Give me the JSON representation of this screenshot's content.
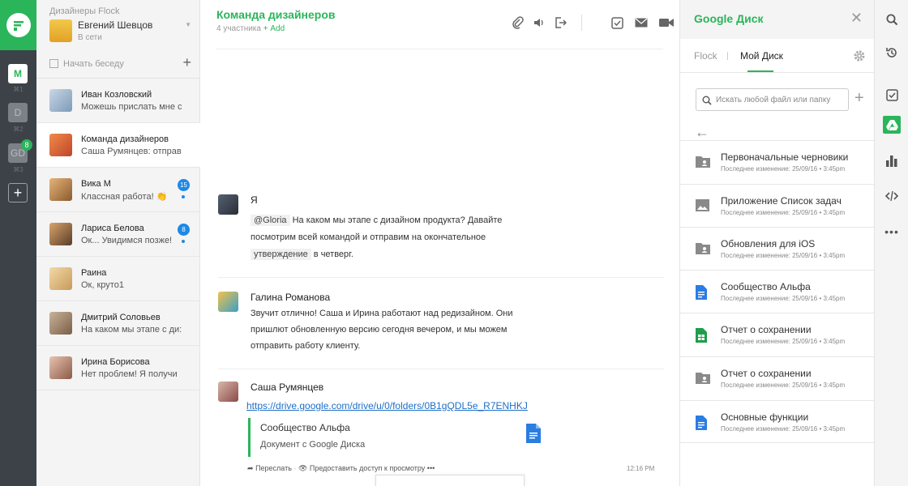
{
  "rail": {
    "teams": [
      {
        "letter": "M",
        "shortcut": "⌘1"
      },
      {
        "letter": "D",
        "shortcut": "⌘2"
      },
      {
        "letter": "GD",
        "shortcut": "⌘3",
        "badge": "8"
      }
    ]
  },
  "sidebar": {
    "team_name": "Дизайнеры Flock",
    "user_name": "Евгений Шевцов",
    "user_status": "В сети",
    "new_conversation": "Начать беседу",
    "conversations": [
      {
        "name": "Иван Козловский",
        "message": "Можешь прислать мне с"
      },
      {
        "name": "Команда дизайнеров",
        "message": "Саша Румянцев: отправ"
      },
      {
        "name": "Вика М",
        "message": "Классная работа! 👏",
        "badge": "15"
      },
      {
        "name": "Лариса Белова",
        "message": "Ок... Увидимся позже!",
        "badge": "8"
      },
      {
        "name": "Раина",
        "message": "Ок, круто1"
      },
      {
        "name": "Дмитрий Соловьев",
        "message": "На каком мы этапе с ди:"
      },
      {
        "name": "Ирина Борисова",
        "message": "Нет проблем! Я получи"
      }
    ]
  },
  "chat": {
    "title": "Команда дизайнеров",
    "members": "4 участника",
    "add_label": "+ Add",
    "messages": [
      {
        "author": "Я",
        "mention": "@Gloria",
        "text_a": " На каком мы этапе с дизайном продукта? Давайте посмотрим всей командой и отправим на окончательное ",
        "tag": "утверждение",
        "text_b": " в четверг."
      },
      {
        "author": "Галина Романова",
        "text": "Звучит отлично! Саша и Ирина работают над редизайном. Они пришлют обновленную версию сегодня вечером, и мы можем отправить работу клиенту."
      },
      {
        "author": "Саша Румянцев",
        "link": "https://drive.google.com/drive/u/0/folders/0B1gQDL5e_R7ENHKJ",
        "card_title": "Сообщество Альфа",
        "card_subtitle": "Документ с Google Диска",
        "forward": "Переслать",
        "share": "Предоставить доступ к просмотру",
        "time": "12:16 PM"
      }
    ]
  },
  "drive": {
    "title": "Google Диск",
    "tab_flock": "Flock",
    "tab_mine": "Мой Диск",
    "search_placeholder": "Искать любой файл или папку",
    "files": [
      {
        "name": "Первоначальные черновики",
        "meta": "Последнее изменение: 25/09/16 • 3:45pm",
        "icon": "shared-folder-icon"
      },
      {
        "name": "Приложение Список задач",
        "meta": "Последнее изменение: 25/09/16 • 3:45pm",
        "icon": "image-icon"
      },
      {
        "name": "Обновления для iOS",
        "meta": "Последнее изменение: 25/09/16 • 3:45pm",
        "icon": "shared-folder-icon"
      },
      {
        "name": "Сообщество Альфа",
        "meta": "Последнее изменение: 25/09/16 • 3:45pm",
        "icon": "google-doc-icon"
      },
      {
        "name": "Отчет о сохранении",
        "meta": "Последнее изменение: 25/09/16 • 3:45pm",
        "icon": "google-sheet-icon"
      },
      {
        "name": "Отчет о сохранении",
        "meta": "Последнее изменение: 25/09/16 • 3:45pm",
        "icon": "shared-folder-icon"
      },
      {
        "name": "Основные функции",
        "meta": "Последнее изменение: 25/09/16 • 3:45pm",
        "icon": "google-doc-icon"
      }
    ]
  },
  "colors": {
    "accent": "#2ab55a",
    "rail": "#3d4248",
    "badge": "#1e88e5",
    "link": "#1e6ec8"
  }
}
